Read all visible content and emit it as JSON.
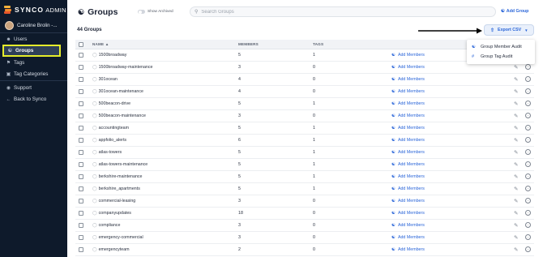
{
  "colors": {
    "sidebar_bg": "#0e1a2b",
    "accent": "#2b66d9",
    "highlight": "#e5ec2b"
  },
  "sidebar": {
    "logo": {
      "brand": "SYNCO",
      "suffix": "ADMIN"
    },
    "user_name": "Caroline Brolin -...",
    "items": [
      {
        "label": "Users",
        "icon": "user-icon"
      },
      {
        "label": "Groups",
        "icon": "groups-icon",
        "active": true
      },
      {
        "label": "Tags",
        "icon": "tag-icon"
      },
      {
        "label": "Tag Categories",
        "icon": "tag-categories-icon"
      },
      {
        "label": "Support",
        "icon": "support-icon"
      },
      {
        "label": "Back to Synco",
        "icon": "back-arrow-icon"
      }
    ]
  },
  "header": {
    "title": "Groups",
    "toggle_label": "Show Archived",
    "search_placeholder": "Search Groups",
    "add_group_label": "Add Group"
  },
  "toolbar": {
    "count_label": "44 Groups",
    "export_label": "Export CSV",
    "export_menu": [
      {
        "label": "Group Member Audit",
        "icon": "group-member-icon"
      },
      {
        "label": "Group Tag Audit",
        "icon": "hashtag-icon"
      }
    ]
  },
  "table": {
    "columns": [
      "NAME ▲",
      "MEMBERS",
      "TAGS"
    ],
    "action_label": "Add Members",
    "rows": [
      {
        "name": "1500broadway",
        "members": "5",
        "tags": "1"
      },
      {
        "name": "1500broadway-maintenance",
        "members": "3",
        "tags": "0"
      },
      {
        "name": "301ocean",
        "members": "4",
        "tags": "0"
      },
      {
        "name": "301ocean-maintenance",
        "members": "4",
        "tags": "0"
      },
      {
        "name": "500beacon-drive",
        "members": "5",
        "tags": "1"
      },
      {
        "name": "500beacon-maintenance",
        "members": "3",
        "tags": "0"
      },
      {
        "name": "accountingteam",
        "members": "5",
        "tags": "1"
      },
      {
        "name": "appfolio_alerts",
        "members": "6",
        "tags": "1"
      },
      {
        "name": "atlas-towers",
        "members": "5",
        "tags": "1"
      },
      {
        "name": "atlas-towers-maintenance",
        "members": "5",
        "tags": "1"
      },
      {
        "name": "berkshire-maintenance",
        "members": "5",
        "tags": "1"
      },
      {
        "name": "berkshire_apartments",
        "members": "5",
        "tags": "1"
      },
      {
        "name": "commercial-leasing",
        "members": "3",
        "tags": "0"
      },
      {
        "name": "companyupdates",
        "members": "18",
        "tags": "0"
      },
      {
        "name": "compliance",
        "members": "3",
        "tags": "0"
      },
      {
        "name": "emergency-commercial",
        "members": "3",
        "tags": "0"
      },
      {
        "name": "emergencyteam",
        "members": "2",
        "tags": "0"
      }
    ]
  }
}
